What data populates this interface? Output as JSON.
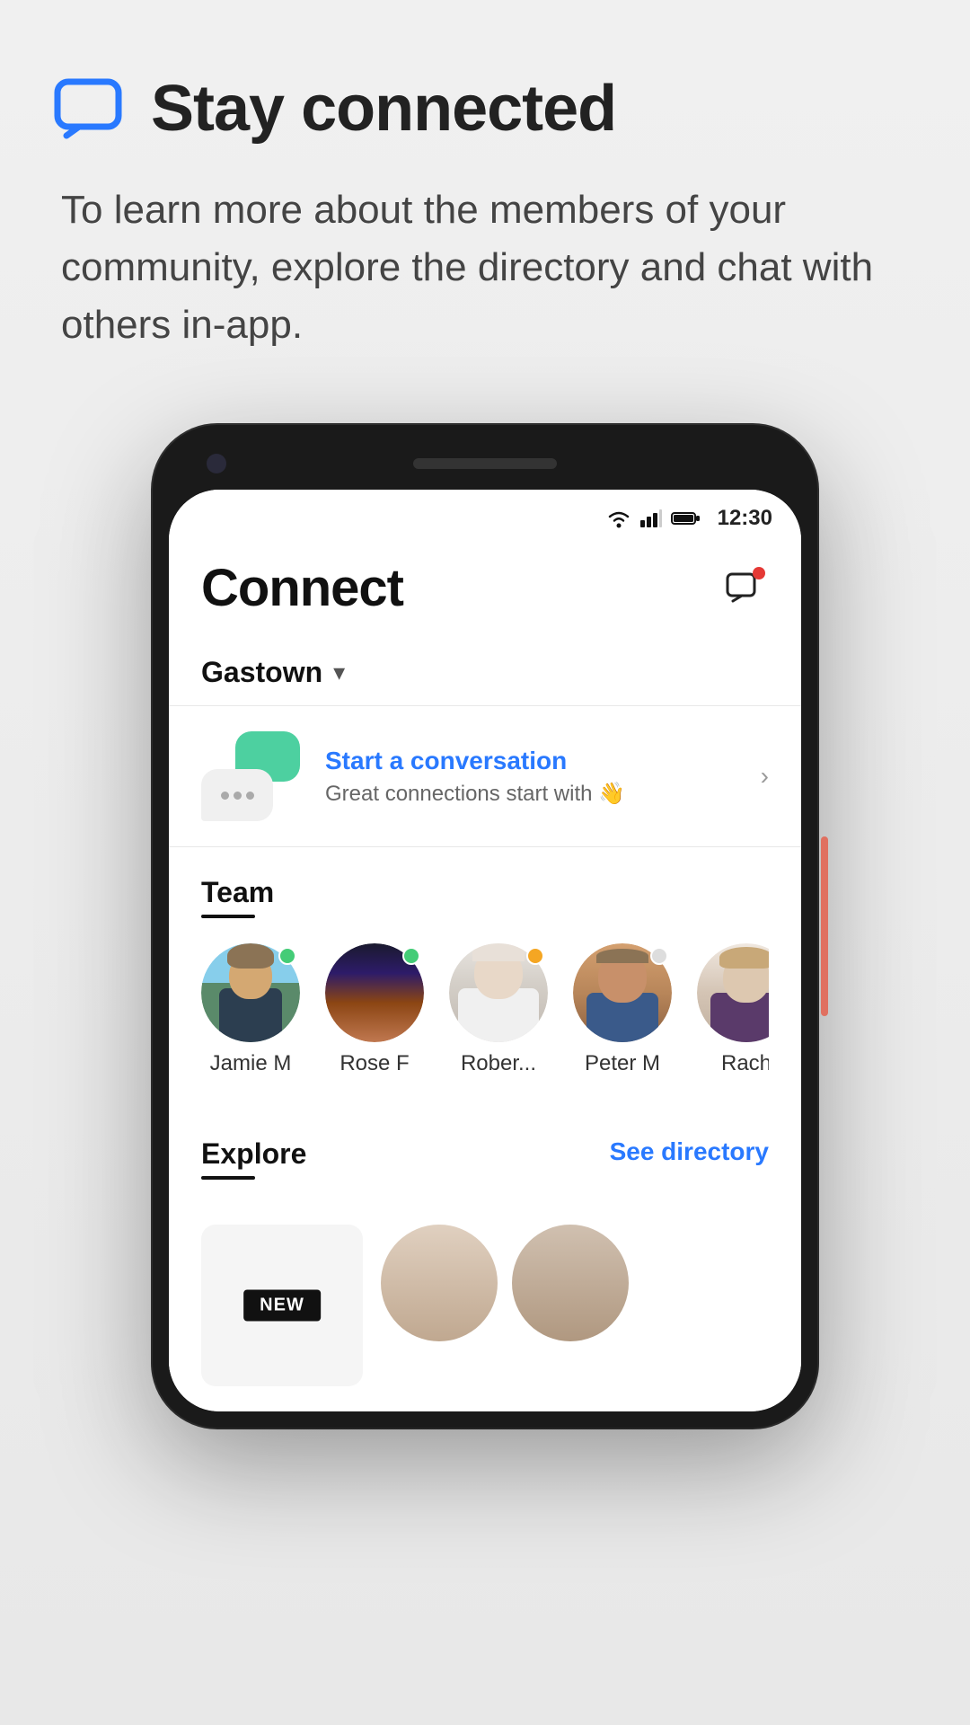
{
  "header": {
    "icon_name": "chat-bubble-icon",
    "title": "Stay connected",
    "description": "To learn more about the members of your community, explore the directory and chat with others in-app."
  },
  "phone": {
    "status_bar": {
      "time": "12:30"
    },
    "app_title": "Connect",
    "community": {
      "name": "Gastown",
      "chevron": "▾"
    },
    "start_conversation": {
      "title": "Start a conversation",
      "subtitle": "Great connections start with 👋",
      "chevron": "›"
    },
    "team_section": {
      "label": "Team",
      "members": [
        {
          "name": "Jamie M",
          "status": "green"
        },
        {
          "name": "Rose F",
          "status": "green"
        },
        {
          "name": "Rober...",
          "status": "orange"
        },
        {
          "name": "Peter M",
          "status": "grey"
        },
        {
          "name": "Rach",
          "status": "none"
        }
      ]
    },
    "explore_section": {
      "label": "Explore",
      "see_directory": "See directory",
      "new_badge": "NEW"
    }
  },
  "colors": {
    "blue_accent": "#2979ff",
    "green_bubble": "#4dd0a0",
    "red_dot": "#e53935"
  }
}
